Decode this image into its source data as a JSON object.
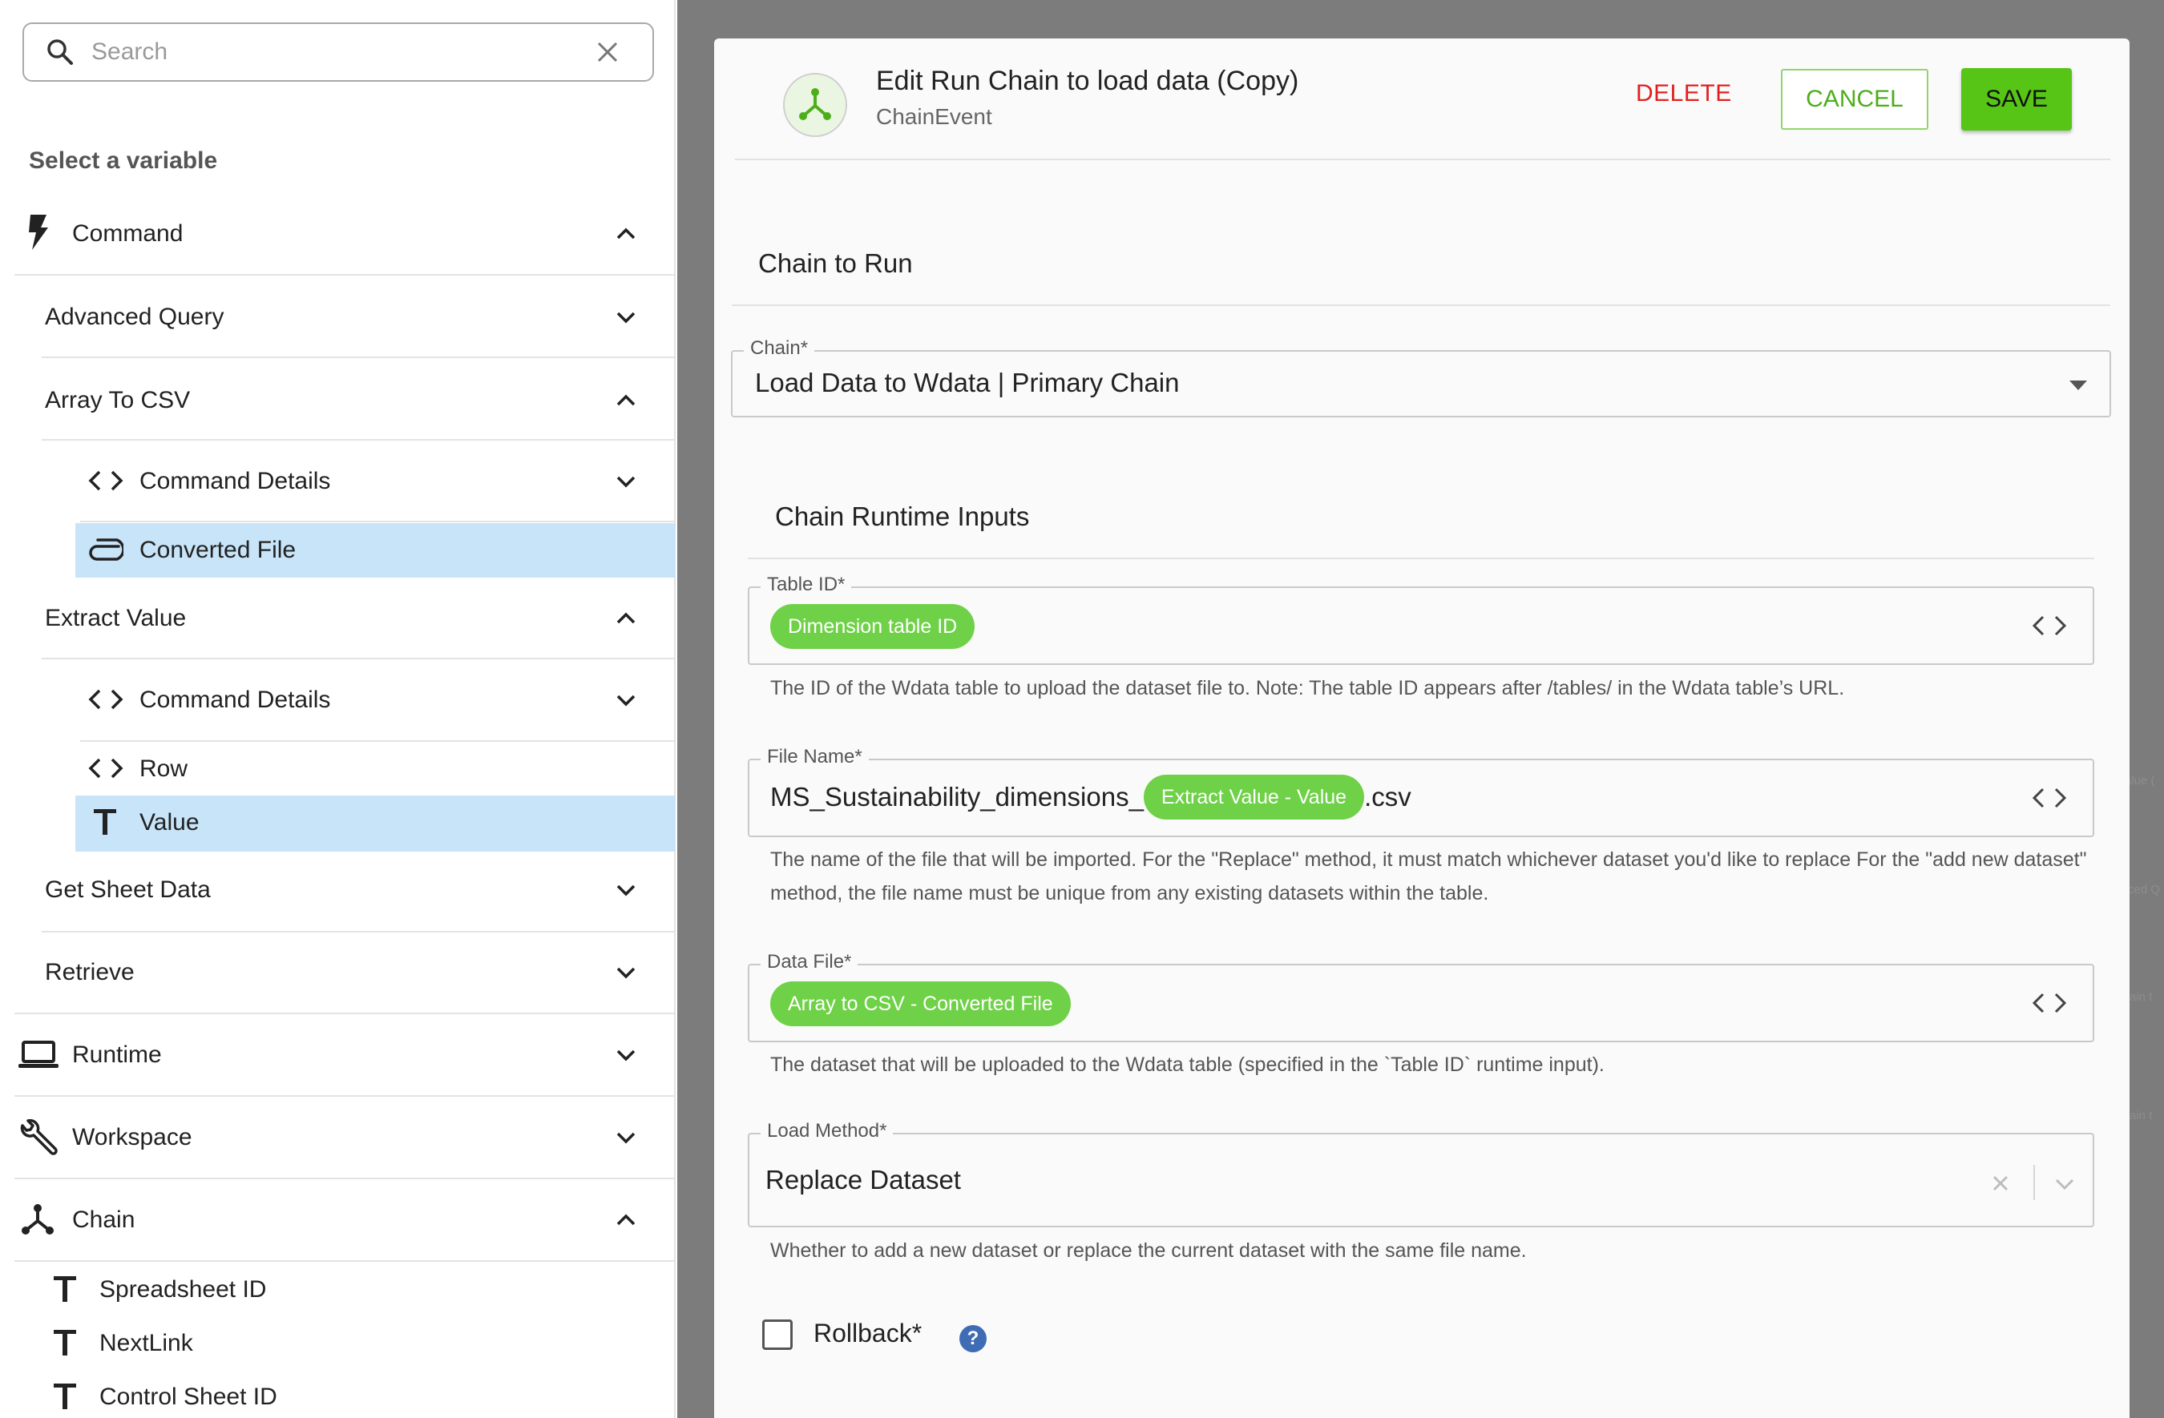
{
  "sidebar": {
    "search_placeholder": "Search",
    "heading": "Select a variable",
    "command": {
      "label": "Command",
      "icon": "lightning-icon"
    },
    "advanced_query": "Advanced Query",
    "array_to_csv": "Array To CSV",
    "array_command_details": "Command Details",
    "converted_file": "Converted File",
    "extract_value": "Extract Value",
    "extract_command_details": "Command Details",
    "row": "Row",
    "value": "Value",
    "get_sheet_data": "Get Sheet Data",
    "retrieve": "Retrieve",
    "runtime": {
      "label": "Runtime",
      "icon": "laptop-icon"
    },
    "workspace": {
      "label": "Workspace",
      "icon": "wrench-icon"
    },
    "chain": {
      "label": "Chain",
      "icon": "chain-icon"
    },
    "spreadsheet_id": "Spreadsheet ID",
    "nextlink": "NextLink",
    "control_sheet_id": "Control Sheet ID"
  },
  "background": {
    "fragments": [
      "alue (",
      "ced Q",
      "ain t",
      "ain t"
    ]
  },
  "modal": {
    "title": "Edit Run Chain to load data (Copy)",
    "subtitle": "ChainEvent",
    "delete_label": "DELETE",
    "cancel_label": "CANCEL",
    "save_label": "SAVE",
    "chain_to_run": "Chain to Run",
    "chain_field": {
      "label": "Chain*",
      "value": "Load Data to Wdata | Primary Chain"
    },
    "runtime_inputs": "Chain Runtime Inputs",
    "table_id": {
      "label": "Table ID*",
      "chip": "Dimension table ID",
      "help": "The ID of the Wdata table to upload the dataset file to. Note: The table ID appears after /tables/ in the Wdata table’s URL."
    },
    "file_name": {
      "label": "File Name*",
      "prefix": "MS_Sustainability_dimensions_",
      "chip": "Extract Value - Value",
      "suffix": ".csv",
      "help_line1": "The name of the file that will be imported. For the \"Replace\" method, it must match whichever dataset you'd like to replace For the \"add new dataset\"",
      "help_line2": "method, the file name must be unique from any existing datasets within the table."
    },
    "data_file": {
      "label": "Data File*",
      "chip": "Array to CSV - Converted File",
      "help": "The dataset that will be uploaded to the Wdata table (specified in the `Table ID` runtime input)."
    },
    "load_method": {
      "label": "Load Method*",
      "value": "Replace Dataset",
      "help": "Whether to add a new dataset or replace the current dataset with the same file name."
    },
    "rollback_label": "Rollback*",
    "help_icon_glyph": "?"
  },
  "colors": {
    "accent_green": "#56c516",
    "chip_green": "#6fd147",
    "delete_red": "#e02020",
    "selected_row": "#c7e4f8",
    "help_blue": "#3f6db5"
  }
}
